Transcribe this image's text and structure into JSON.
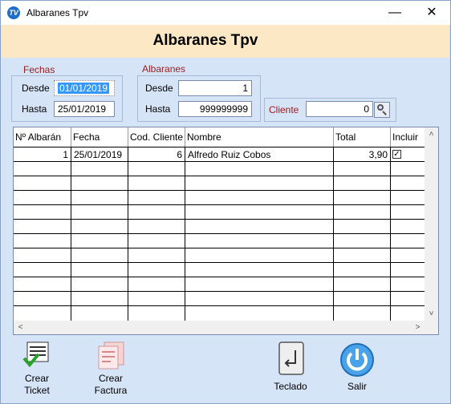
{
  "window": {
    "title": "Albaranes Tpv",
    "app_icon": "tpv-app-icon",
    "min_glyph": "—",
    "close_glyph": "✕"
  },
  "header": {
    "title": "Albaranes Tpv",
    "band_color": "#fde8c6"
  },
  "filters": {
    "fechas": {
      "label": "Fechas",
      "desde_label": "Desde",
      "desde_value": "01/01/2019",
      "hasta_label": "Hasta",
      "hasta_value": "25/01/2019"
    },
    "albaranes": {
      "label": "Albaranes",
      "desde_label": "Desde",
      "desde_value": "1",
      "hasta_label": "Hasta",
      "hasta_value": "999999999"
    },
    "cliente": {
      "label": "Cliente",
      "value": "0",
      "search_icon": "search-icon"
    }
  },
  "grid": {
    "columns": [
      "Nº Albarán",
      "Fecha",
      "Cod. Cliente",
      "Nombre",
      "Total",
      "Incluir"
    ],
    "rows": [
      {
        "albaran": "1",
        "fecha": "25/01/2019",
        "cod_cliente": "6",
        "nombre": "Alfredo Ruiz Cobos",
        "total": "3,90",
        "incluir": true
      }
    ],
    "empty_rows": 11,
    "scroll_up": "˄",
    "scroll_down": "˅",
    "scroll_left": "<",
    "scroll_right": ">"
  },
  "toolbar": {
    "crear_ticket": {
      "line1": "Crear",
      "line2": "Ticket",
      "icon": "ticket-check-icon"
    },
    "crear_factura": {
      "line1": "Crear",
      "line2": "Factura",
      "icon": "invoice-icon"
    },
    "teclado": {
      "label": "Teclado",
      "icon": "keyboard-enter-icon"
    },
    "salir": {
      "label": "Salir",
      "icon": "power-icon"
    }
  },
  "colors": {
    "accent_label": "#9b1c1c",
    "window_bg": "#d6e4f7",
    "selection": "#3399ff"
  }
}
